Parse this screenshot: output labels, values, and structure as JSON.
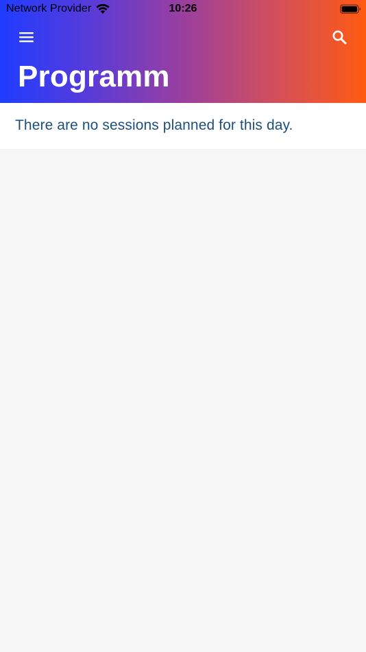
{
  "status_bar": {
    "carrier": "Network Provider",
    "time": "10:26",
    "wifi_icon": "wifi-icon",
    "battery_icon": "battery-icon"
  },
  "header": {
    "title": "Programm",
    "menu_icon": "hamburger-menu-icon",
    "search_icon": "search-icon",
    "gradient_colors": [
      "#1f3cff",
      "#9a3f9e",
      "#ff5a12"
    ]
  },
  "content": {
    "empty_message": "There are no sessions planned for this day.",
    "message_color": "#1d4f7c",
    "background_color": "#f6f6f6"
  }
}
